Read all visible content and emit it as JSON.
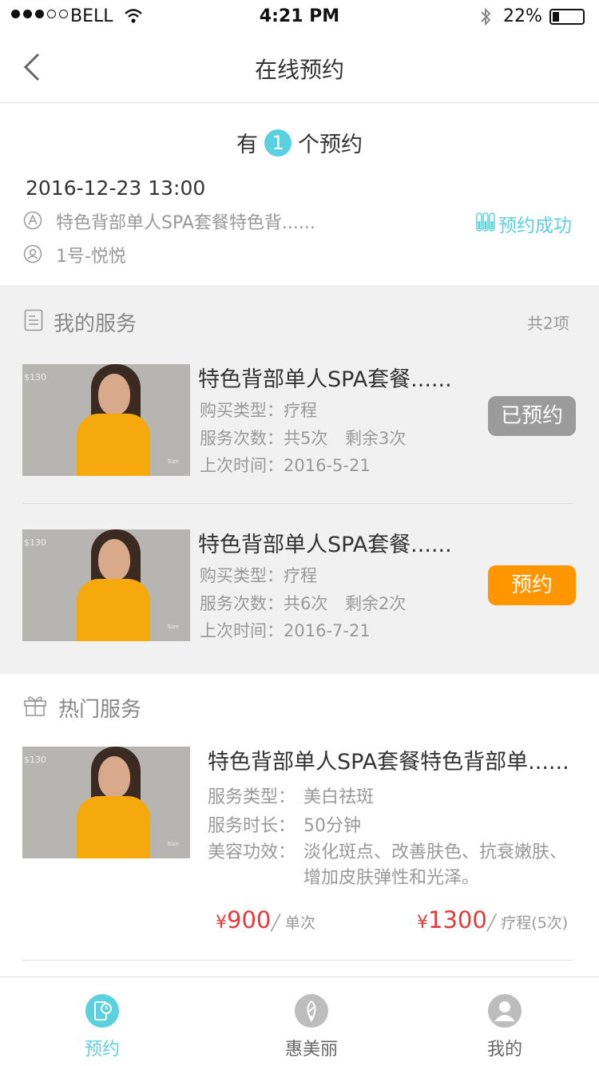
{
  "status_bar": {
    "carrier": "BELL",
    "time": "4:21 PM",
    "battery": "22%"
  },
  "nav": {
    "title": "在线预约"
  },
  "appointment": {
    "count_prefix": "有",
    "count": "1",
    "count_suffix": "个预约",
    "datetime": "2016-12-23 13:00",
    "service": "特色背部单人SPA套餐特色背......",
    "staff": "1号-悦悦",
    "status": "预约成功"
  },
  "my_services": {
    "title": "我的服务",
    "total": "共2项",
    "items": [
      {
        "price_tag": "$130",
        "title": "特色背部单人SPA套餐......",
        "type": "购买类型：疗程",
        "times": "服务次数：共5次",
        "remain": "剩余3次",
        "last": "上次时间：2016-5-21",
        "button": "已预约"
      },
      {
        "price_tag": "$130",
        "title": "特色背部单人SPA套餐......",
        "type": "购买类型：疗程",
        "times": "服务次数：共6次",
        "remain": "剩余2次",
        "last": "上次时间：2016-7-21",
        "button": "预约"
      }
    ]
  },
  "hot_services": {
    "title": "热门服务",
    "item": {
      "price_tag": "$130",
      "title": "特色背部单人SPA套餐特色背部单......",
      "type_label": "服务类型：",
      "type": "美白祛斑",
      "duration_label": "服务时长：",
      "duration": "50分钟",
      "effect_label": "美容功效：",
      "effect_line1": "淡化斑点、改善肤色、抗衰嫩肤、",
      "effect_line2": "增加皮肤弹性和光泽。",
      "currency": "¥",
      "price_single": "900",
      "unit_single": "╱ 单次",
      "price_course": "1300",
      "unit_course": "╱ 疗程(5次)"
    }
  },
  "tabbar": {
    "tab1": "预约",
    "tab2": "惠美丽",
    "tab3": "我的"
  },
  "colors": {
    "accent": "#5bd0df",
    "orange": "#ff9500",
    "booked_gray": "#9b9b9b",
    "price_red": "#e23b3b"
  }
}
